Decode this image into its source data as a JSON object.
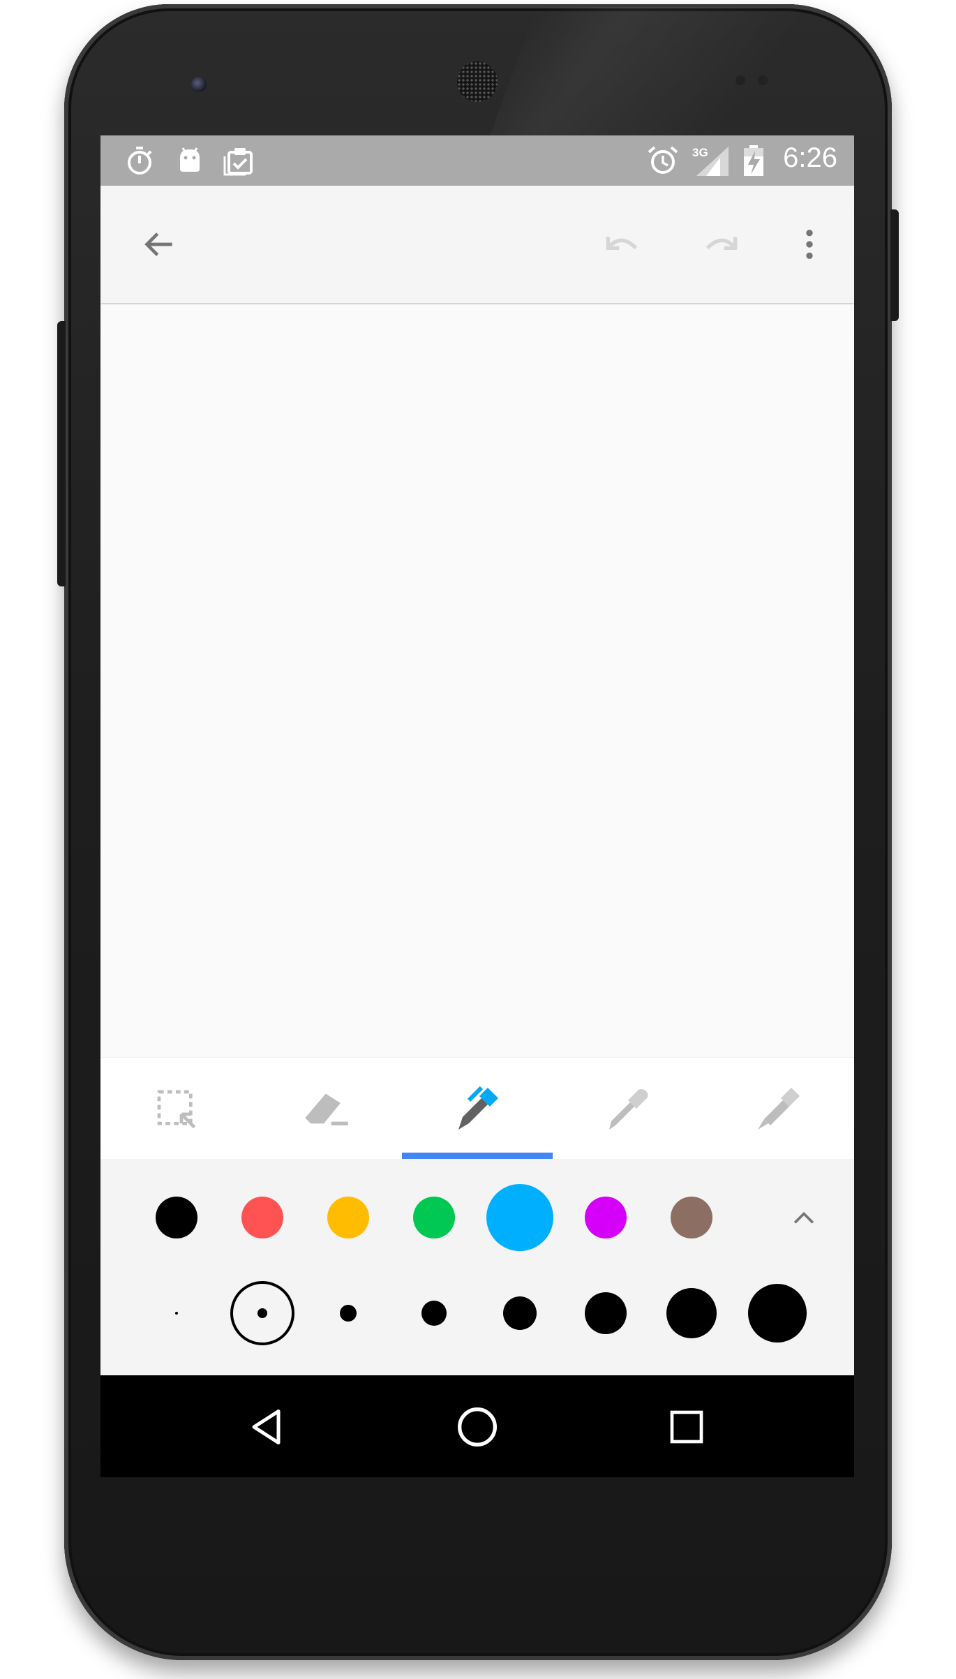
{
  "status_bar": {
    "time": "6:26",
    "network": "3G",
    "left_icons": [
      "stopwatch-icon",
      "android-icon",
      "clipboard-check-icon"
    ],
    "right_icons": [
      "alarm-icon",
      "signal-3g-icon",
      "battery-charging-icon"
    ]
  },
  "app_bar": {
    "back_icon": "arrow-back-icon",
    "undo_icon": "undo-icon",
    "redo_icon": "redo-icon",
    "menu_icon": "more-vert-icon"
  },
  "tools": [
    {
      "name": "select",
      "icon": "selection-icon",
      "selected": false
    },
    {
      "name": "eraser",
      "icon": "eraser-icon",
      "selected": false
    },
    {
      "name": "pen",
      "icon": "pen-icon",
      "selected": true
    },
    {
      "name": "marker",
      "icon": "marker-icon",
      "selected": false
    },
    {
      "name": "highlighter",
      "icon": "highlighter-icon",
      "selected": false
    }
  ],
  "colors": [
    "#000000",
    "#ff5252",
    "#ffbc00",
    "#00c853",
    "#00b0ff",
    "#d500f9",
    "#8d6e63"
  ],
  "selected_color": "#00b0ff",
  "accent_color": "#4285f4",
  "stroke_sizes": [
    1,
    2,
    3,
    4,
    5,
    6,
    7,
    8
  ],
  "selected_stroke_size": 2,
  "expand_icon": "chevron-up-icon",
  "nav_bar": {
    "back_icon": "nav-back-icon",
    "home_icon": "nav-home-icon",
    "recents_icon": "nav-recents-icon"
  }
}
